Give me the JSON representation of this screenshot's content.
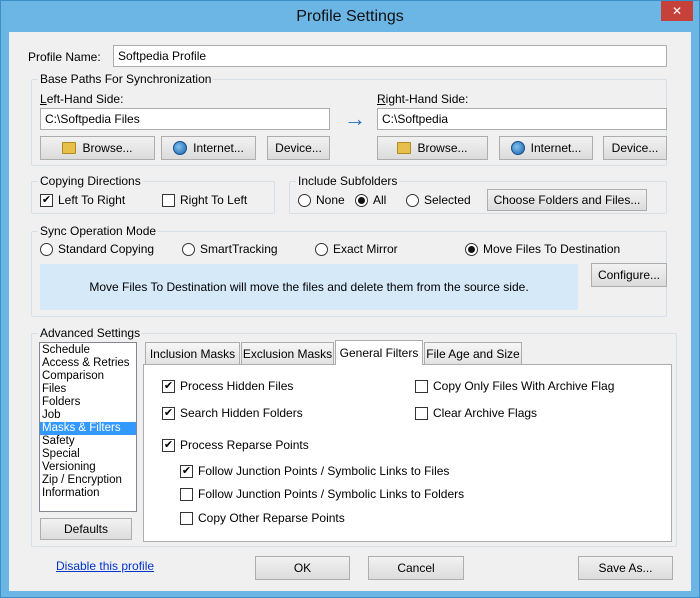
{
  "window": {
    "title": "Profile Settings",
    "close_glyph": "✕"
  },
  "profile": {
    "name_label": "Profile Name:",
    "name_value": "Softpedia Profile"
  },
  "base_paths": {
    "group_title": "Base Paths For Synchronization",
    "left": {
      "label": "Left-Hand Side:",
      "value": "C:\\Softpedia Files",
      "browse": "Browse...",
      "internet": "Internet...",
      "device": "Device..."
    },
    "right": {
      "label": "Right-Hand Side:",
      "value": "C:\\Softpedia",
      "browse": "Browse...",
      "internet": "Internet...",
      "device": "Device..."
    },
    "arrow": "→"
  },
  "copying_directions": {
    "group_title": "Copying Directions",
    "left_to_right": "Left To Right",
    "right_to_left": "Right To Left",
    "check": "✔"
  },
  "subfolders": {
    "group_title": "Include Subfolders",
    "none": "None",
    "all": "All",
    "selected": "Selected",
    "choose_button": "Choose Folders and Files..."
  },
  "sync_mode": {
    "group_title": "Sync Operation Mode",
    "standard": "Standard Copying",
    "smart": "SmartTracking",
    "exact": "Exact Mirror",
    "move": "Move Files To Destination",
    "description": "Move Files To Destination will move the files and delete them from the source side.",
    "configure_button": "Configure..."
  },
  "advanced": {
    "group_title": "Advanced Settings",
    "list": [
      "Schedule",
      "Access & Retries",
      "Comparison",
      "Files",
      "Folders",
      "Job",
      "Masks & Filters",
      "Safety",
      "Special",
      "Versioning",
      "Zip / Encryption",
      "Information"
    ],
    "selected_index": 6,
    "defaults_button": "Defaults",
    "tabs": [
      "Inclusion Masks",
      "Exclusion Masks",
      "General Filters",
      "File Age and Size"
    ],
    "active_tab": 2,
    "filters": {
      "process_hidden": "Process Hidden Files",
      "search_hidden": "Search Hidden Folders",
      "process_reparse": "Process Reparse Points",
      "follow_files": "Follow Junction Points / Symbolic Links to Files",
      "follow_folders": "Follow Junction Points / Symbolic Links to Folders",
      "copy_other": "Copy Other Reparse Points",
      "archive_only": "Copy Only Files With Archive Flag",
      "clear_archive": "Clear Archive Flags"
    }
  },
  "footer": {
    "disable_link": "Disable this profile",
    "ok": "OK",
    "cancel": "Cancel",
    "save_as": "Save As..."
  }
}
